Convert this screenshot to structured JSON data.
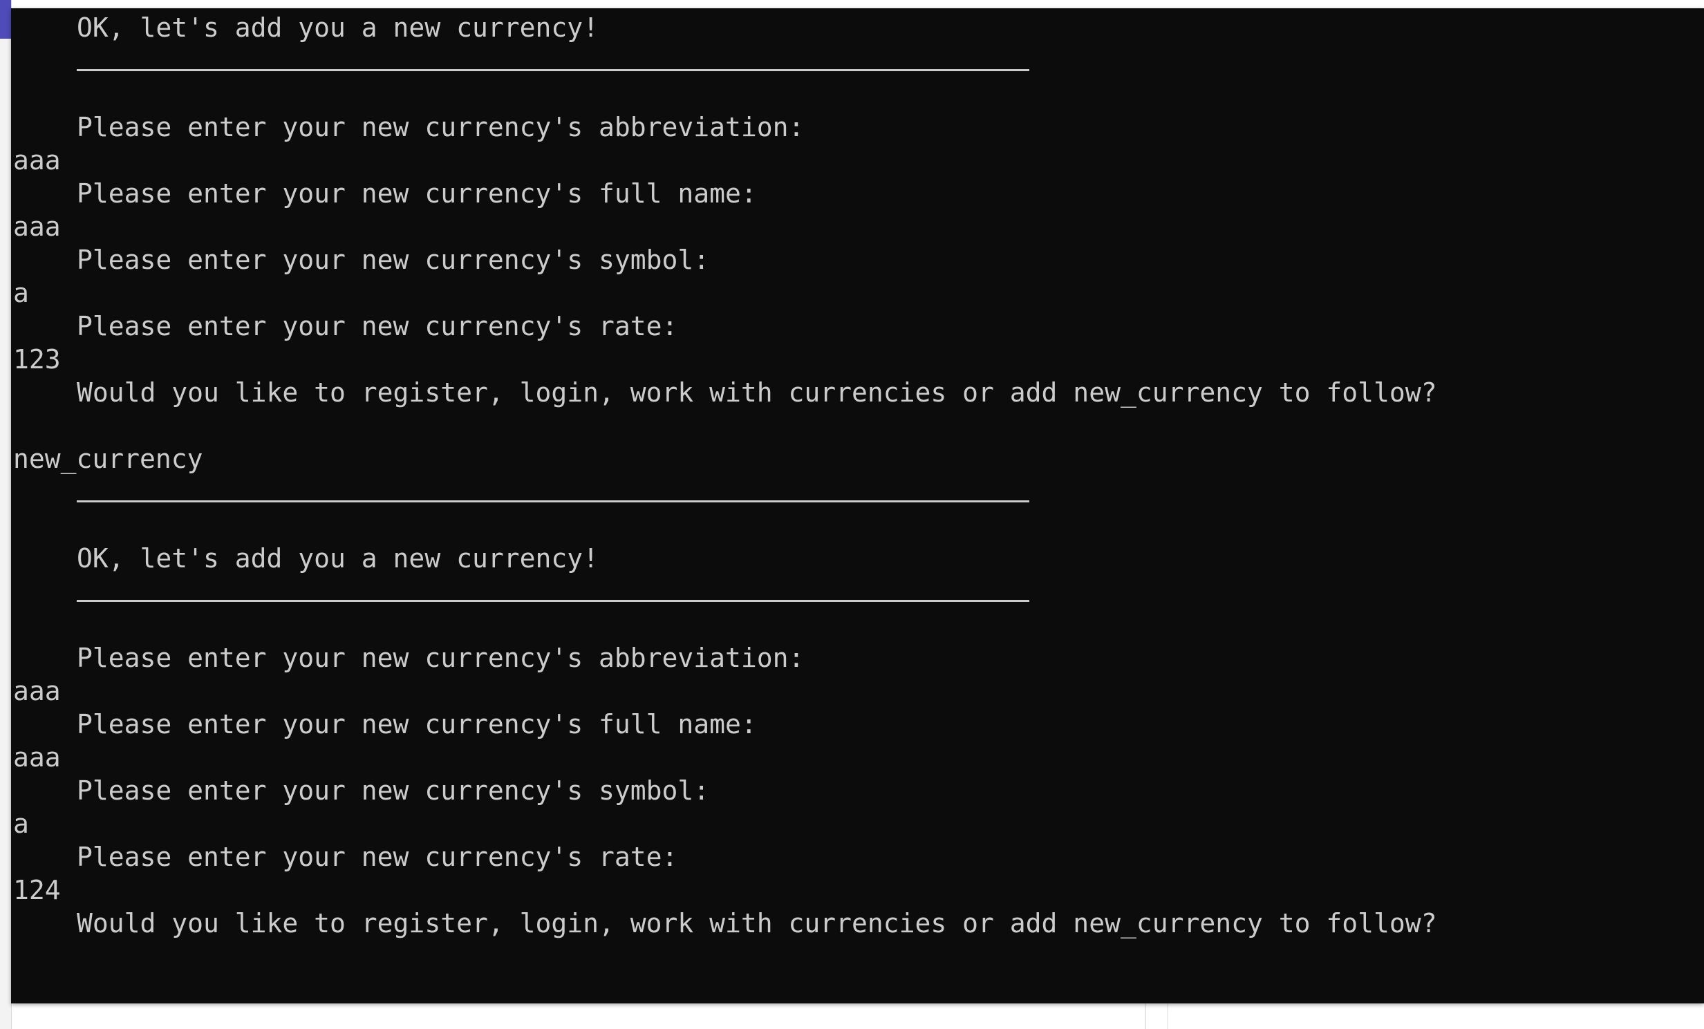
{
  "console": {
    "lines": [
      {
        "type": "prompt",
        "text": "OK, let's add you a new currency!"
      },
      {
        "type": "rule"
      },
      {
        "type": "blank"
      },
      {
        "type": "prompt",
        "text": "Please enter your new currency's abbreviation:"
      },
      {
        "type": "input",
        "text": "aaa"
      },
      {
        "type": "prompt",
        "text": "Please enter your new currency's full name:"
      },
      {
        "type": "input",
        "text": "aaa"
      },
      {
        "type": "prompt",
        "text": "Please enter your new currency's symbol:"
      },
      {
        "type": "input",
        "text": "a"
      },
      {
        "type": "prompt",
        "text": "Please enter your new currency's rate:"
      },
      {
        "type": "input",
        "text": "123"
      },
      {
        "type": "prompt",
        "text": "Would you like to register, login, work with currencies or add new_currency to follow?"
      },
      {
        "type": "blank"
      },
      {
        "type": "input",
        "text": "new_currency"
      },
      {
        "type": "rule"
      },
      {
        "type": "blank"
      },
      {
        "type": "prompt",
        "text": "OK, let's add you a new currency!"
      },
      {
        "type": "rule"
      },
      {
        "type": "blank"
      },
      {
        "type": "prompt",
        "text": "Please enter your new currency's abbreviation:"
      },
      {
        "type": "input",
        "text": "aaa"
      },
      {
        "type": "prompt",
        "text": "Please enter your new currency's full name:"
      },
      {
        "type": "input",
        "text": "aaa"
      },
      {
        "type": "prompt",
        "text": "Please enter your new currency's symbol:"
      },
      {
        "type": "input",
        "text": "a"
      },
      {
        "type": "prompt",
        "text": "Please enter your new currency's rate:"
      },
      {
        "type": "input",
        "text": "124"
      },
      {
        "type": "prompt",
        "text": "Would you like to register, login, work with currencies or add new_currency to follow?"
      }
    ]
  },
  "colors": {
    "console_background": "#0c0c0c",
    "console_text": "#cccccc",
    "background_accent": "#4f4bb8"
  }
}
